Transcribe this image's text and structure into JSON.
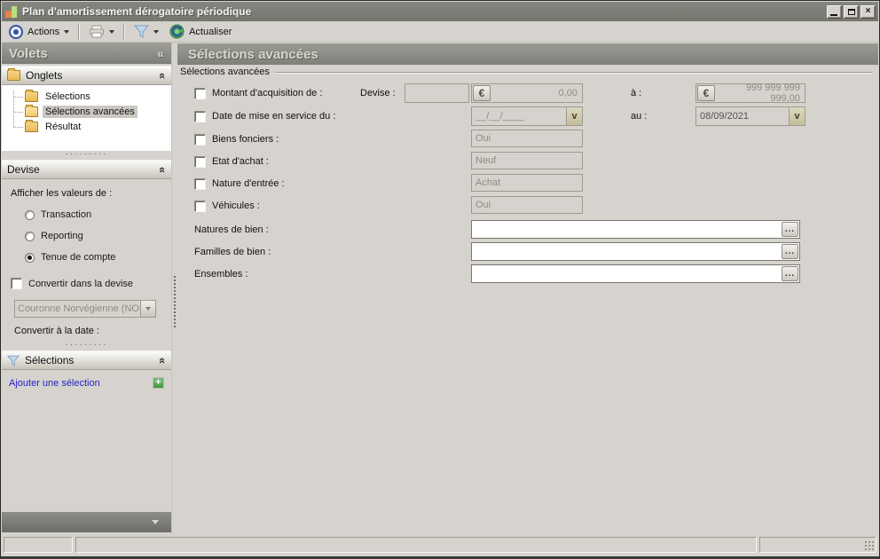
{
  "window": {
    "title": "Plan d'amortissement dérogatoire périodique",
    "controls": {
      "minimize": "",
      "maximize": "",
      "close": "×"
    }
  },
  "toolbar": {
    "actions_label": "Actions",
    "actualiser_label": "Actualiser"
  },
  "icons": {
    "panel_collapse": "«",
    "section_collapse": "«",
    "dropdown_chevron": "v",
    "euro": "€",
    "ellipsis": "...",
    "plus": "+",
    "drag_handle": "·········"
  },
  "sidebar": {
    "title": "Volets",
    "onglets": {
      "title": "Onglets",
      "items": [
        {
          "label": "Sélections"
        },
        {
          "label": "Sélections avancées"
        },
        {
          "label": "Résultat"
        }
      ]
    },
    "devise": {
      "title": "Devise",
      "caption": "Afficher les valeurs de :",
      "radios": [
        {
          "label": "Transaction"
        },
        {
          "label": "Reporting"
        },
        {
          "label": "Tenue de compte"
        }
      ],
      "convert_checkbox_label": "Convertir dans la devise",
      "currency_value": "Couronne Norvégienne (NOK",
      "convert_date_label": "Convertir à la date :"
    },
    "selections": {
      "title": "Sélections",
      "add_link_label": "Ajouter une sélection"
    }
  },
  "main": {
    "header": "Sélections avancées",
    "fieldset_legend": "Sélections avancées",
    "rows": {
      "montant": {
        "label": "Montant d'acquisition de :",
        "devise_label": "Devise :",
        "currency_input": "",
        "amount_from": "0,00",
        "a_label": "à :",
        "amount_to": "999 999 999 999,00"
      },
      "date": {
        "label": "Date de mise en service du :",
        "value": "__/__/____",
        "au_label": "au :",
        "to_value": "08/09/2021"
      },
      "biens_fonciers": {
        "label": "Biens fonciers :",
        "value": "Oui"
      },
      "etat_achat": {
        "label": "Etat d'achat :",
        "value": "Neuf"
      },
      "nature_entree": {
        "label": "Nature d'entrée :",
        "value": "Achat"
      },
      "vehicules": {
        "label": "Véhicules :",
        "value": "Oui"
      },
      "natures_bien": {
        "label": "Natures de bien :",
        "value": ""
      },
      "familles_bien": {
        "label": "Familles de bien :",
        "value": ""
      },
      "ensembles": {
        "label": "Ensembles :",
        "value": ""
      }
    }
  },
  "colors": {
    "surface": "#d6d3ce",
    "header_gray": "#8c8c86",
    "titlebar": "#7d7d77",
    "link_blue": "#2323c8",
    "folder_gold": "#e9b854",
    "plus_green": "#3f9a3f",
    "funnel_blue": "#b9d3ea"
  }
}
